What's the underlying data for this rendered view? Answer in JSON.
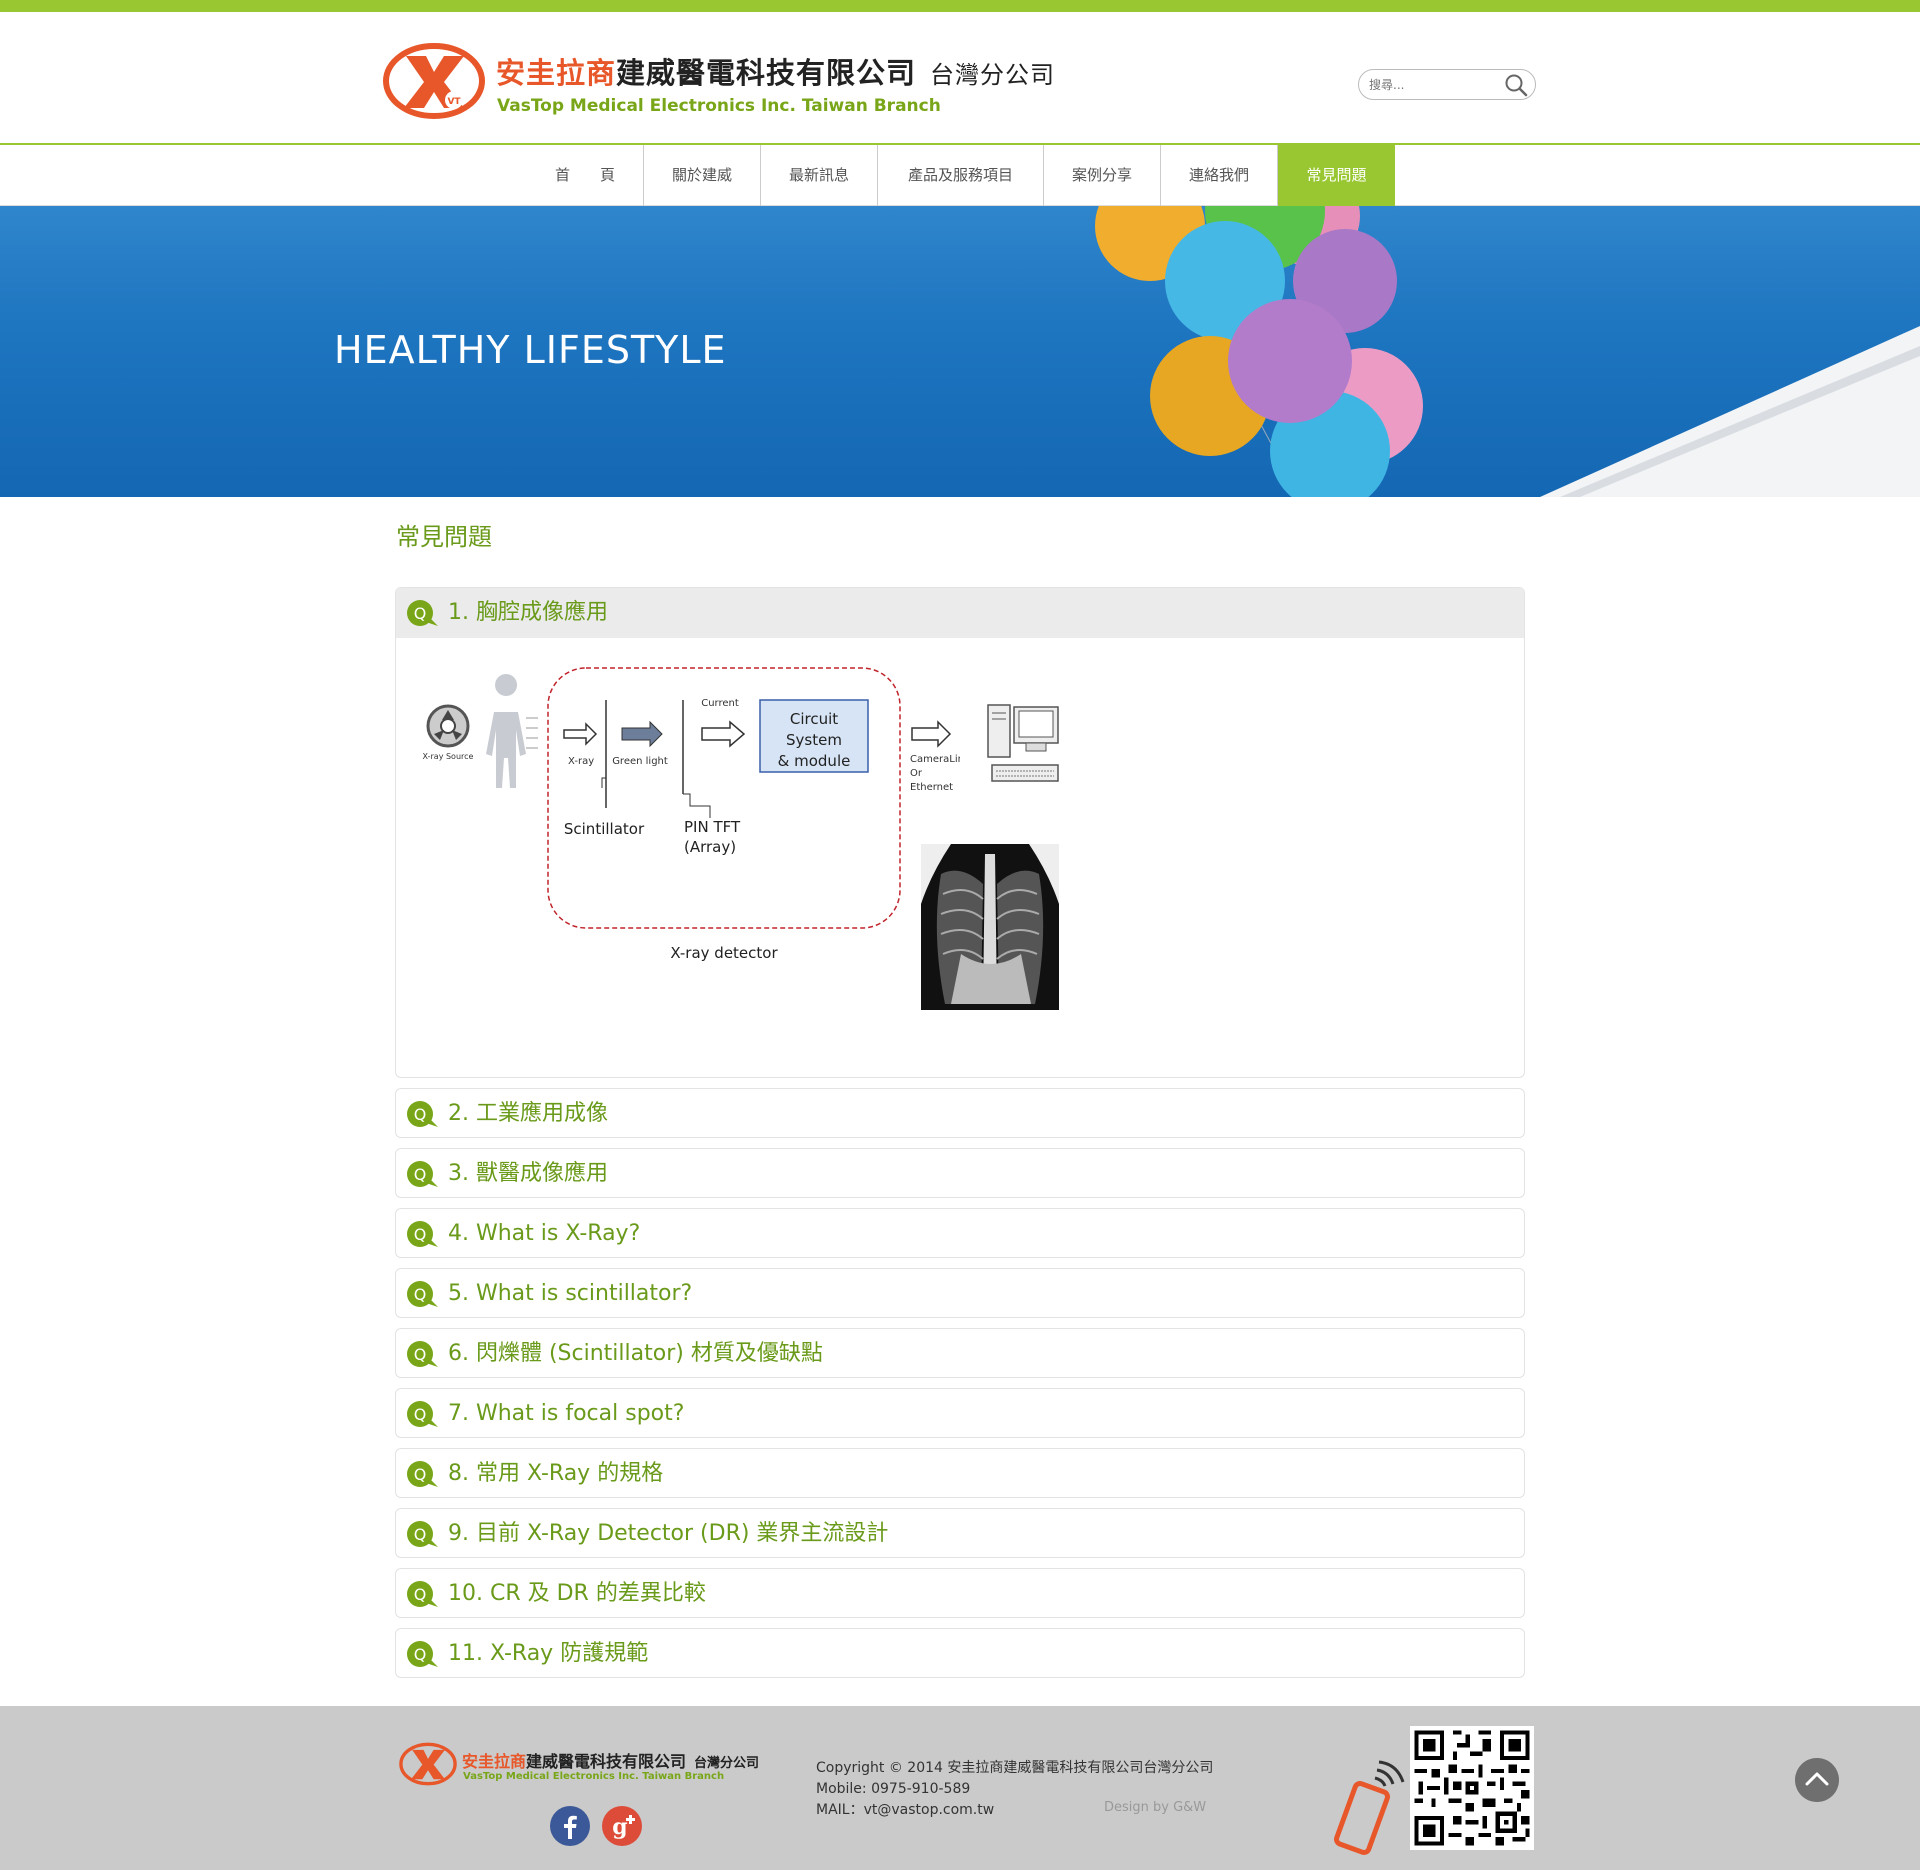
{
  "logo": {
    "cn_red": "安圭拉商",
    "cn_black": "建威醫電科技有限公司",
    "branch": "台灣分公司",
    "en": "VasTop Medical Electronics Inc. Taiwan Branch",
    "mark_text": "VT"
  },
  "search": {
    "placeholder": "搜尋..."
  },
  "nav": [
    {
      "label": "首　　頁"
    },
    {
      "label": "關於建威"
    },
    {
      "label": "最新訊息"
    },
    {
      "label": "產品及服務項目"
    },
    {
      "label": "案例分享"
    },
    {
      "label": "連絡我們"
    },
    {
      "label": "常見問題"
    }
  ],
  "banner": {
    "headline": "HEALTHY LIFESTYLE"
  },
  "page_title": "常見問題",
  "diagram": {
    "xray_source": "X-ray Source",
    "xray": "X-ray",
    "green_light": "Green light",
    "scintillator": "Scintillator",
    "current": "Current",
    "pin_tft": "PIN TFT",
    "array": "(Array)",
    "circuit_1": "Circuit",
    "circuit_2": "System",
    "circuit_3": "& module",
    "cameralink": "CameraLink",
    "or": "Or",
    "ethernet": "Ethernet",
    "detector": "X-ray detector"
  },
  "faqs": [
    {
      "label": "1. 胸腔成像應用"
    },
    {
      "label": "2. 工業應用成像"
    },
    {
      "label": "3. 獸醫成像應用"
    },
    {
      "label": "4. What is X-Ray?"
    },
    {
      "label": "5. What is scintillator?"
    },
    {
      "label": "6. 閃爍體 (Scintillator) 材質及優缺點"
    },
    {
      "label": "7. What is focal spot?"
    },
    {
      "label": "8. 常用 X-Ray 的規格"
    },
    {
      "label": "9. 目前 X-Ray Detector (DR) 業界主流設計"
    },
    {
      "label": "10. CR 及 DR 的差異比較"
    },
    {
      "label": "11. X-Ray 防護規範"
    }
  ],
  "footer": {
    "copyright": "Copyright © 2014 安圭拉商建威醫電科技有限公司台灣分公司",
    "mobile": "Mobile: 0975-910-589",
    "mail": "MAIL：vt@vastop.com.tw",
    "design": "Design by G&W"
  },
  "colors": {
    "accent": "#98c731",
    "text_green": "#6a9a1a",
    "logo_red": "#e8572a"
  },
  "icons": [
    "search-icon",
    "q-icon",
    "facebook-icon",
    "google-plus-icon",
    "phone-icon",
    "qr-code",
    "arrow-up-icon"
  ]
}
